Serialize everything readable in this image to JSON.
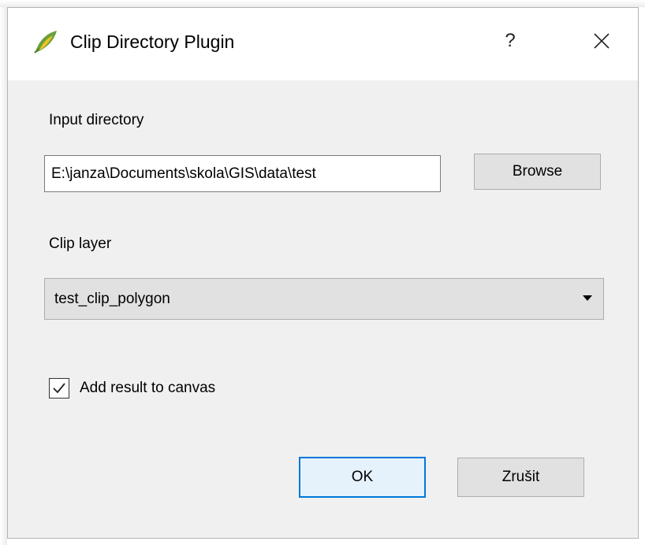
{
  "window": {
    "title": "Clip Directory Plugin",
    "help_label": "?",
    "app_icon": "qgis-logo-icon",
    "close_icon": "close-icon"
  },
  "form": {
    "input_directory_label": "Input directory",
    "input_directory_value": "E:\\janza\\Documents\\skola\\GIS\\data\\test",
    "browse_label": "Browse",
    "clip_layer_label": "Clip layer",
    "clip_layer_selected": "test_clip_polygon",
    "add_result_label": "Add result to canvas",
    "add_result_checked": true
  },
  "buttons": {
    "ok_label": "OK",
    "cancel_label": "Zrušit"
  },
  "colors": {
    "focus_border": "#0078d7",
    "dialog_bg": "#f0f0f0",
    "logo_green": "#6aa03c",
    "logo_yellow": "#eec41f"
  }
}
